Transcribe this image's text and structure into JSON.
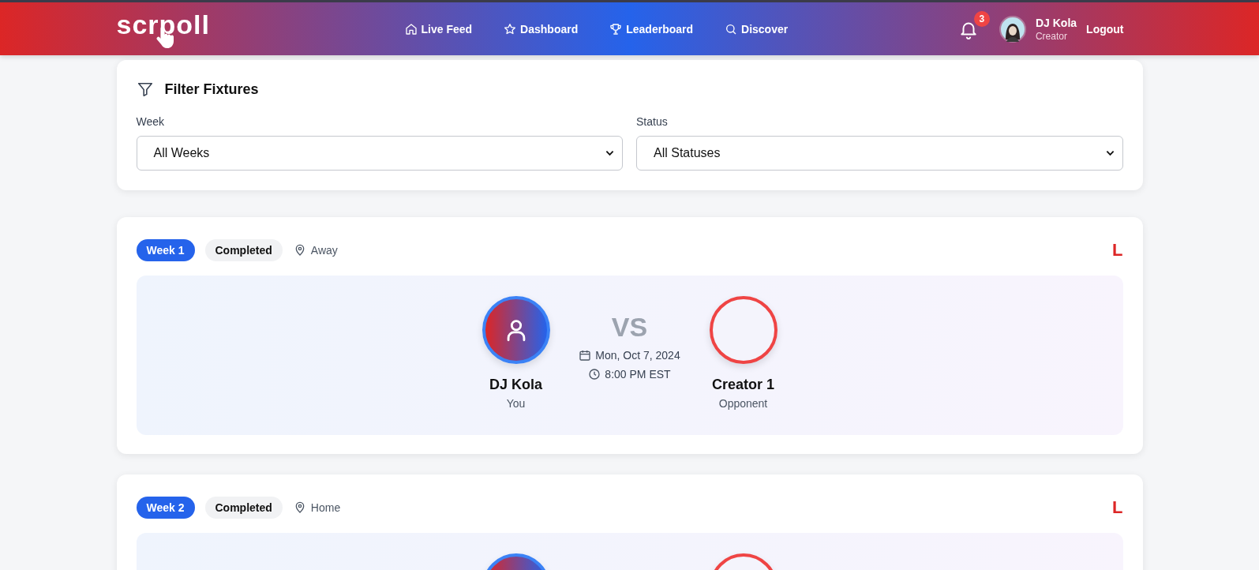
{
  "header": {
    "logo": "scrpoll",
    "nav": [
      {
        "label": "Live Feed"
      },
      {
        "label": "Dashboard"
      },
      {
        "label": "Leaderboard"
      },
      {
        "label": "Discover"
      }
    ],
    "notifications": "3",
    "user": {
      "name": "DJ Kola",
      "role": "Creator"
    },
    "logout": "Logout"
  },
  "filter": {
    "title": "Filter Fixtures",
    "fields": [
      {
        "label": "Week",
        "value": "All Weeks"
      },
      {
        "label": "Status",
        "value": "All Statuses"
      }
    ]
  },
  "fixtures": [
    {
      "week": "Week 1",
      "status": "Completed",
      "venue": "Away",
      "result": "L",
      "vs": "VS",
      "date": "Mon, Oct 7, 2024",
      "time": "8:00 PM EST",
      "players": [
        {
          "kind": "self",
          "name": "DJ Kola",
          "role": "You"
        },
        {
          "kind": "opponent",
          "name": "Creator 1",
          "role": "Opponent"
        }
      ]
    },
    {
      "week": "Week 2",
      "status": "Completed",
      "venue": "Home",
      "result": "L",
      "players": [
        {
          "kind": "self"
        },
        {
          "kind": "opponent"
        }
      ]
    }
  ]
}
